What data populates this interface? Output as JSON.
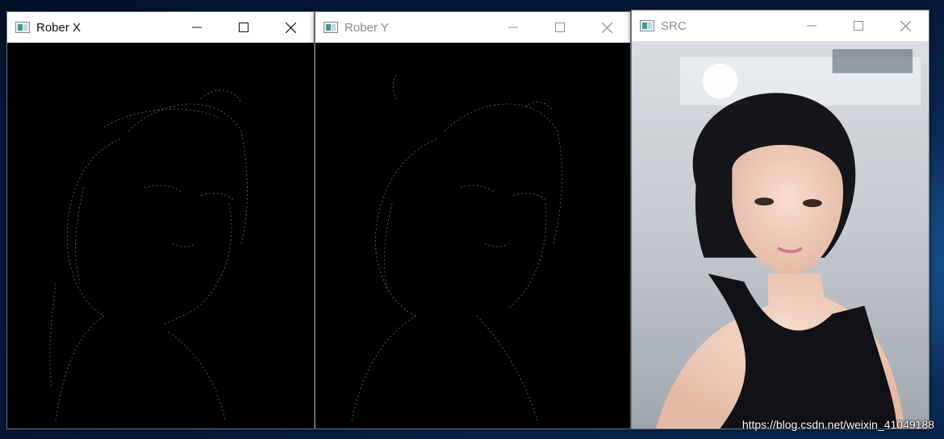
{
  "windows": [
    {
      "title": "Rober X",
      "active": true
    },
    {
      "title": "Rober Y",
      "active": false
    },
    {
      "title": "SRC",
      "active": false
    }
  ],
  "watermark": "https://blog.csdn.net/weixin_41049188",
  "colors": {
    "desktop": "#0c2c57",
    "titlebar": "#ffffff",
    "edge_line": "#c8c3ba",
    "inactive_text": "#8a8a8a"
  }
}
